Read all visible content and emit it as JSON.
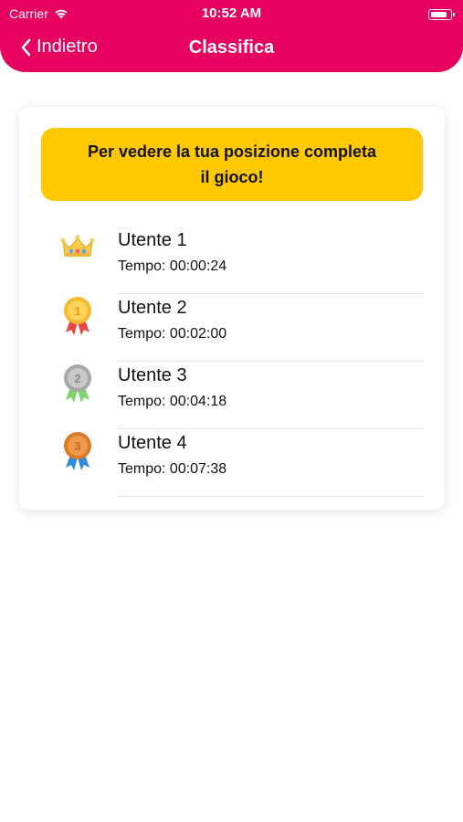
{
  "status_bar": {
    "carrier": "Carrier",
    "time": "10:52 AM",
    "battery_level": 0.85
  },
  "nav": {
    "back_label": "Indietro",
    "title": "Classifica"
  },
  "colors": {
    "header": "#e6005f",
    "banner": "#ffc800"
  },
  "banner": {
    "line1": "Per vedere la tua posizione completa",
    "line2": "il gioco!"
  },
  "leaderboard": [
    {
      "icon": "crown-icon",
      "name": "Utente 1",
      "time": "Tempo: 00:00:24"
    },
    {
      "icon": "gold-medal-icon",
      "name": "Utente 2",
      "time": "Tempo: 00:02:00"
    },
    {
      "icon": "silver-medal-icon",
      "name": "Utente 3",
      "time": "Tempo: 00:04:18"
    },
    {
      "icon": "bronze-medal-icon",
      "name": "Utente 4",
      "time": "Tempo: 00:07:38"
    }
  ]
}
